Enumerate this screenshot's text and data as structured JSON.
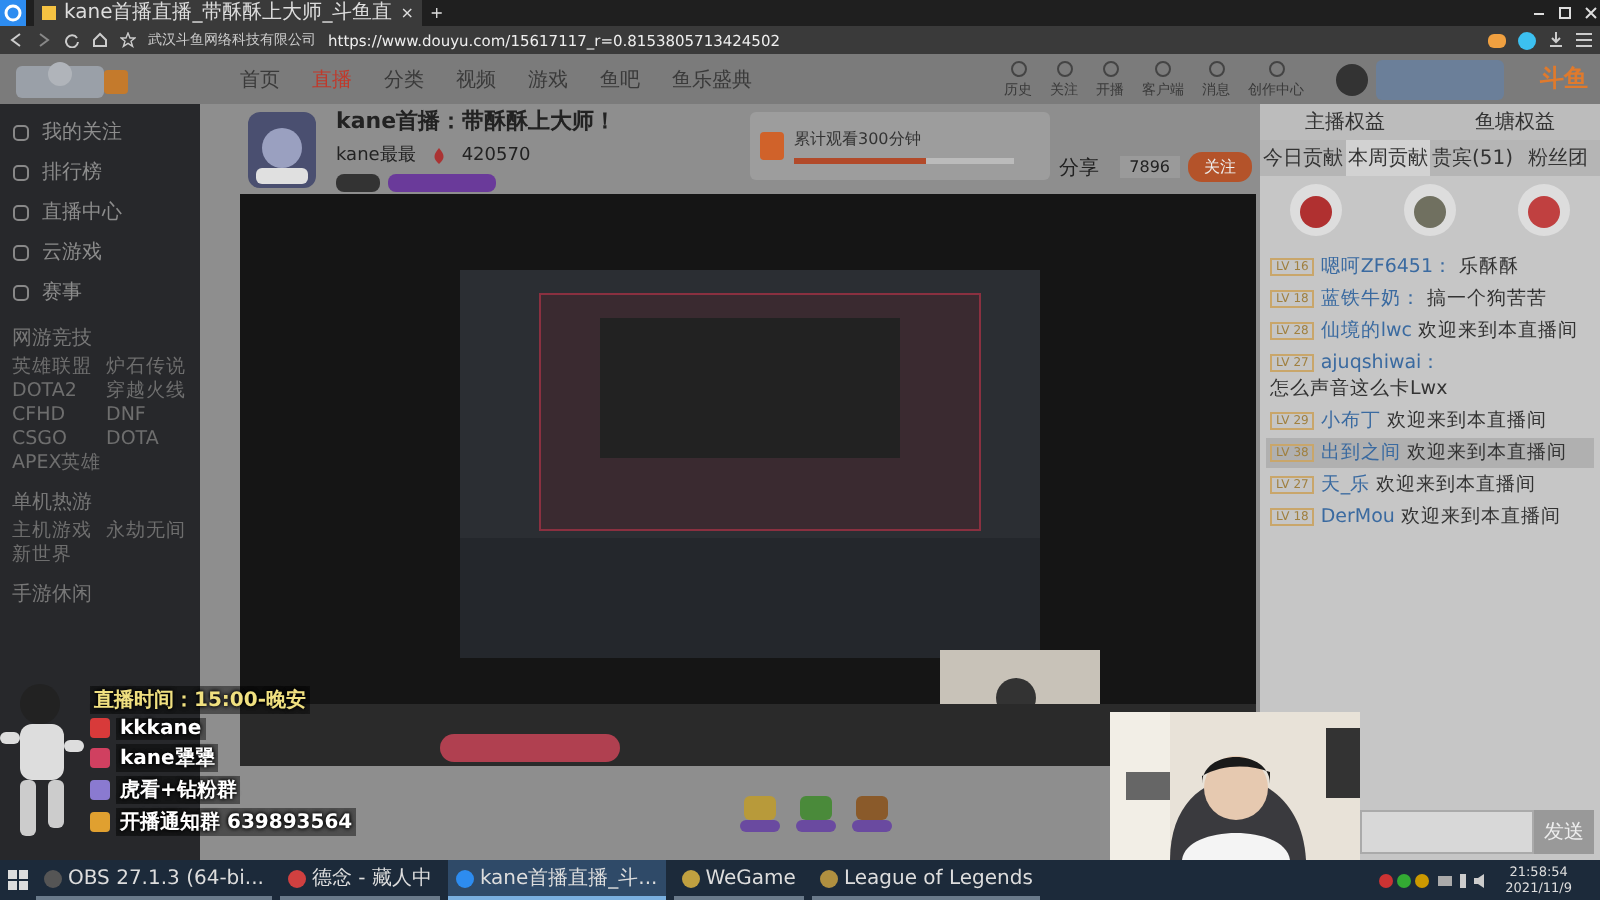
{
  "browser": {
    "tab_title": "kane首播直播_带酥酥上大师_斗鱼直",
    "tab_close": "×",
    "new_tab": "+",
    "company": "武汉斗鱼网络科技有限公司",
    "url": "https://www.douyu.com/15617117_r=0.8153805713424502"
  },
  "site": {
    "nav": [
      {
        "label": "首页",
        "selected": false
      },
      {
        "label": "直播",
        "selected": true
      },
      {
        "label": "分类",
        "selected": false
      },
      {
        "label": "视频",
        "selected": false
      },
      {
        "label": "游戏",
        "selected": false
      },
      {
        "label": "鱼吧",
        "selected": false
      },
      {
        "label": "鱼乐盛典",
        "selected": false
      }
    ],
    "tools": [
      "历史",
      "关注",
      "开播",
      "客户端",
      "消息",
      "创作中心"
    ],
    "brand": "斗鱼"
  },
  "sidebar": {
    "items": [
      "我的关注",
      "排行榜",
      "直播中心",
      "云游戏",
      "赛事"
    ],
    "sections": [
      {
        "title": "网游竞技",
        "games": [
          "英雄联盟",
          "炉石传说",
          "DOTA2",
          "穿越火线",
          "CFHD",
          "DNF",
          "CSGO",
          "DOTA",
          "APEX英雄"
        ]
      },
      {
        "title": "单机热游",
        "games": [
          "主机游戏",
          "永劫无间",
          "新世界"
        ]
      },
      {
        "title": "手游休闲"
      }
    ]
  },
  "streamer": {
    "title": "kane首播：带酥酥上大师！",
    "name": "kane最最",
    "hot": "420570",
    "follows": "7896",
    "follow_button": "关注",
    "share": "分享"
  },
  "task": {
    "title": "累计观看300分钟",
    "level": 0.6
  },
  "ranking": {
    "links": [
      "主播权益",
      "鱼塘权益"
    ],
    "tabs": [
      {
        "label": "今日贡献",
        "selected": false
      },
      {
        "label": "本周贡献",
        "selected": true
      },
      {
        "label": "贵宾(51)",
        "selected": false
      },
      {
        "label": "粉丝团",
        "selected": false
      }
    ]
  },
  "chat": {
    "messages": [
      {
        "level": "LV 16",
        "user": "嗯呵ZF6451：",
        "text": "乐酥酥",
        "highlighted": false
      },
      {
        "level": "LV 18",
        "user": "蓝铁牛奶：",
        "text": "搞一个狗苦苦",
        "highlighted": false
      },
      {
        "level": "LV 28",
        "user": "仙境的lwc",
        "text": "欢迎来到本直播间",
        "highlighted": false
      },
      {
        "level": "LV 27",
        "user": "ajuqshiwai：",
        "text": "怎么声音这么卡Lwx",
        "highlighted": false
      },
      {
        "level": "LV 29",
        "user": "小布丁",
        "text": "欢迎来到本直播间",
        "highlighted": false
      },
      {
        "level": "LV 38",
        "user": "出到之间",
        "text": "欢迎来到本直播间",
        "highlighted": true
      },
      {
        "level": "LV 27",
        "user": "天_乐",
        "text": "欢迎来到本直播间",
        "highlighted": false
      },
      {
        "level": "LV 18",
        "user": "DerMou",
        "text": "欢迎来到本直播间",
        "highlighted": false
      }
    ],
    "send": "发送"
  },
  "overlay": {
    "lines": [
      "直播时间：15:00-晚安",
      "kkkane",
      "kane犟犟",
      "虎看+钻粉群",
      "开播通知群 639893564"
    ]
  },
  "taskbar": {
    "items": [
      {
        "label": "OBS 27.1.3 (64-bi...",
        "selected": false
      },
      {
        "label": "德念 - 藏人中",
        "selected": false
      },
      {
        "label": "kane首播直播_斗...",
        "selected": true
      },
      {
        "label": "WeGame",
        "selected": false
      },
      {
        "label": "League of Legends",
        "selected": false
      }
    ],
    "time": "21:58:54",
    "date": "2021/11/9"
  }
}
